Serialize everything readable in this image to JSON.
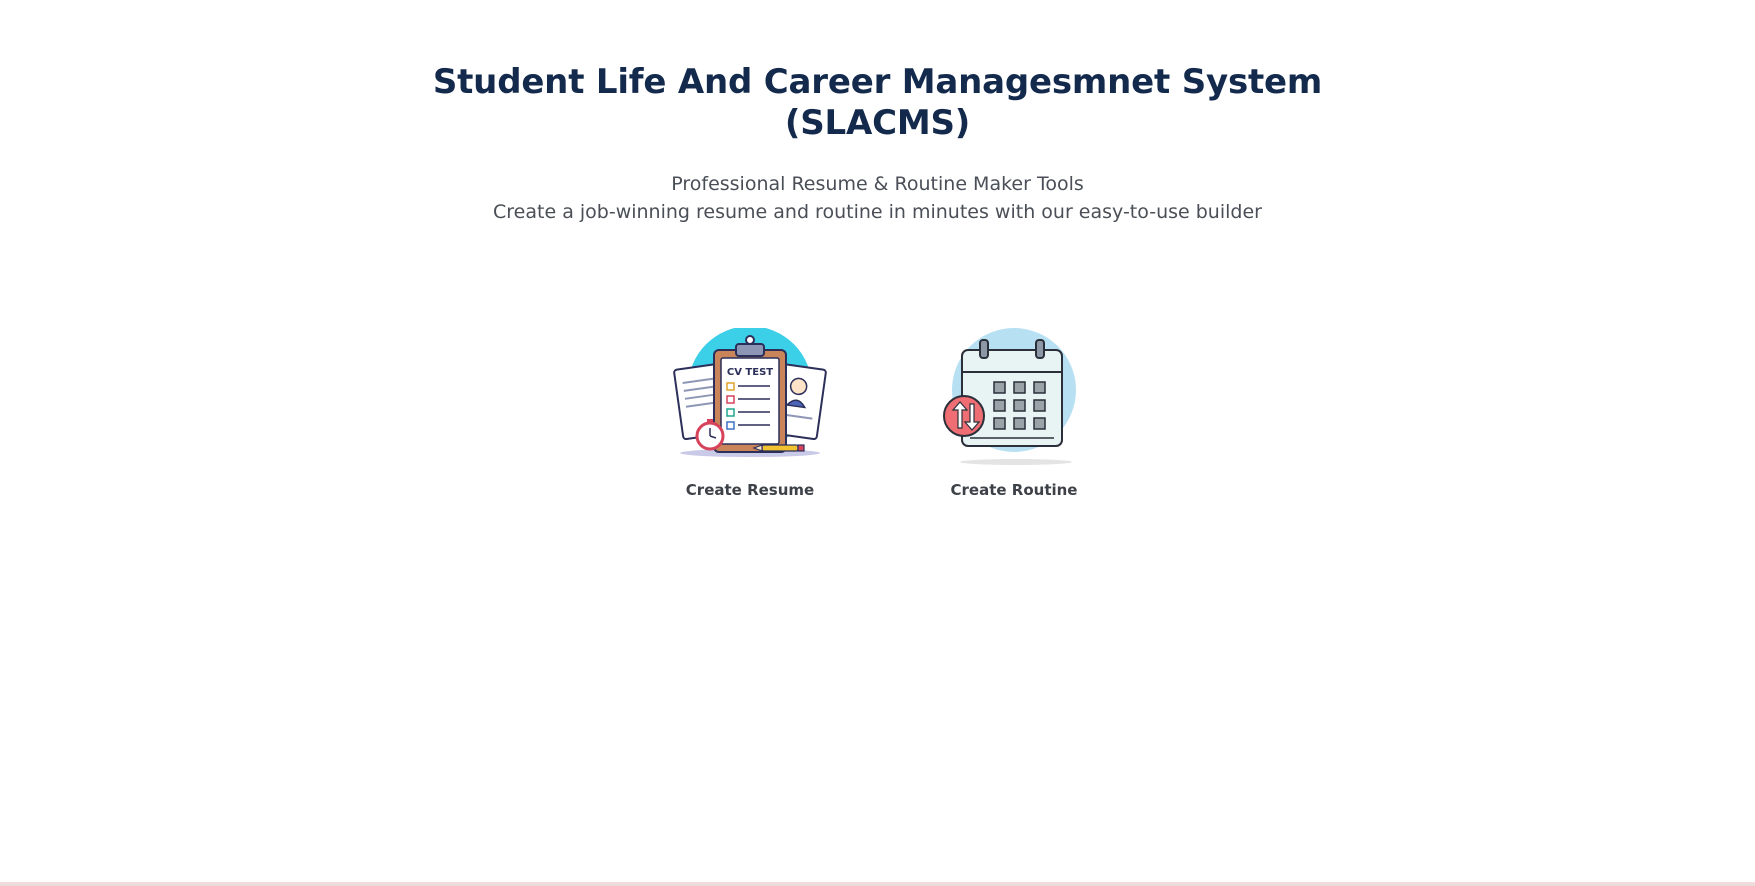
{
  "header": {
    "title": "Student Life And Career Managesmnet System (SLACMS)",
    "subtitle_line1": "Professional Resume & Routine Maker Tools",
    "subtitle_line2": "Create a job-winning resume and routine in minutes with our easy-to-use builder"
  },
  "tools": [
    {
      "label": "Create Resume",
      "icon": "cv-clipboard-illustration",
      "card_text": "CV TEST"
    },
    {
      "label": "Create Routine",
      "icon": "calendar-illustration"
    }
  ],
  "colors": {
    "title": "#132a4d",
    "text": "#4a4f57",
    "accent_cyan": "#3ccfe8",
    "accent_light_blue": "#b7e1f2"
  }
}
